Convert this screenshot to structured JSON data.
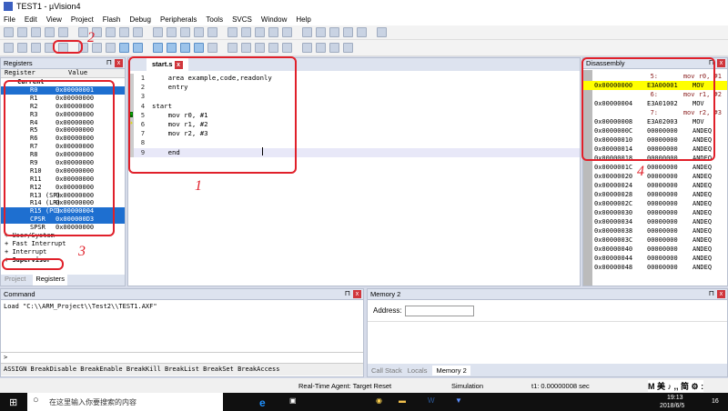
{
  "title": "TEST1 - µVision4",
  "menu": [
    "File",
    "Edit",
    "View",
    "Project",
    "Flash",
    "Debug",
    "Peripherals",
    "Tools",
    "SVCS",
    "Window",
    "Help"
  ],
  "registers": {
    "title": "Registers",
    "col_name": "Register",
    "col_value": "Value",
    "group": "Current",
    "rows": [
      [
        "R0",
        "0x00000001",
        true
      ],
      [
        "R1",
        "0x00000000",
        false
      ],
      [
        "R2",
        "0x00000000",
        false
      ],
      [
        "R3",
        "0x00000000",
        false
      ],
      [
        "R4",
        "0x00000000",
        false
      ],
      [
        "R5",
        "0x00000000",
        false
      ],
      [
        "R6",
        "0x00000000",
        false
      ],
      [
        "R7",
        "0x00000000",
        false
      ],
      [
        "R8",
        "0x00000000",
        false
      ],
      [
        "R9",
        "0x00000000",
        false
      ],
      [
        "R10",
        "0x00000000",
        false
      ],
      [
        "R11",
        "0x00000000",
        false
      ],
      [
        "R12",
        "0x00000000",
        false
      ],
      [
        "R13 (SP)",
        "0x00000000",
        false
      ],
      [
        "R14 (LR)",
        "0x00000000",
        false
      ],
      [
        "R15 (PC)",
        "0x00000004",
        true
      ],
      [
        "CPSR",
        "0x000000D3",
        true
      ],
      [
        "SPSR",
        "0x00000000",
        false
      ]
    ],
    "modes": [
      "User/System",
      "Fast Interrupt",
      "Interrupt",
      "Supervisor"
    ],
    "tabs": [
      "Project",
      "Registers"
    ]
  },
  "editor": {
    "tab": "start.s",
    "lines": [
      "    area example,code,readonly",
      "    entry",
      "",
      "start",
      "    mov r0, #1",
      "    mov r1, #2",
      "    mov r2, #3",
      "",
      "    end"
    ]
  },
  "disassembly": {
    "title": "Disassembly",
    "rows": [
      [
        "src",
        "5:",
        "mov r0, #1"
      ],
      [
        "ins",
        "0x00000000",
        "E3A00001",
        "MOV"
      ],
      [
        "src",
        "6:",
        "mov r1, #2"
      ],
      [
        "ins",
        "0x00000004",
        "E3A01002",
        "MOV"
      ],
      [
        "src",
        "7:",
        "mov r2, #3"
      ],
      [
        "ins",
        "0x00000008",
        "E3A02003",
        "MOV"
      ],
      [
        "ins",
        "0x0000000C",
        "00000000",
        "ANDEQ"
      ],
      [
        "ins",
        "0x00000010",
        "00000000",
        "ANDEQ"
      ],
      [
        "ins",
        "0x00000014",
        "00000000",
        "ANDEQ"
      ],
      [
        "ins",
        "0x00000018",
        "00000000",
        "ANDEQ"
      ],
      [
        "ins",
        "0x0000001C",
        "00000000",
        "ANDEQ"
      ],
      [
        "ins",
        "0x00000020",
        "00000000",
        "ANDEQ"
      ],
      [
        "ins",
        "0x00000024",
        "00000000",
        "ANDEQ"
      ],
      [
        "ins",
        "0x00000028",
        "00000000",
        "ANDEQ"
      ],
      [
        "ins",
        "0x0000002C",
        "00000000",
        "ANDEQ"
      ],
      [
        "ins",
        "0x00000030",
        "00000000",
        "ANDEQ"
      ],
      [
        "ins",
        "0x00000034",
        "00000000",
        "ANDEQ"
      ],
      [
        "ins",
        "0x00000038",
        "00000000",
        "ANDEQ"
      ],
      [
        "ins",
        "0x0000003C",
        "00000000",
        "ANDEQ"
      ],
      [
        "ins",
        "0x00000040",
        "00000000",
        "ANDEQ"
      ],
      [
        "ins",
        "0x00000044",
        "00000000",
        "ANDEQ"
      ],
      [
        "ins",
        "0x00000048",
        "00000000",
        "ANDEQ"
      ]
    ]
  },
  "command": {
    "title": "Command",
    "output": "Load \"C:\\\\ARM_Project\\\\Test2\\\\TEST1.AXF\"",
    "prompt": ">",
    "hints": "ASSIGN BreakDisable BreakEnable BreakKill BreakList BreakSet BreakAccess"
  },
  "memory": {
    "title": "Memory 2",
    "address_label": "Address:",
    "address_value": "",
    "tabs": [
      "Call Stack",
      "Locals",
      "Memory 2"
    ]
  },
  "status": {
    "agent": "Real-Time Agent: Target Reset",
    "mode": "Simulation",
    "time": "t1: 0.00000008 sec"
  },
  "annotations": [
    "1",
    "2",
    "3",
    "4"
  ],
  "taskbar": {
    "search": "在这里输入你要搜索的内容",
    "time": "19:13",
    "date": "2018/6/5",
    "notif": "16",
    "ime": "M 美 ♪ ,, 简 ⚙ :"
  }
}
